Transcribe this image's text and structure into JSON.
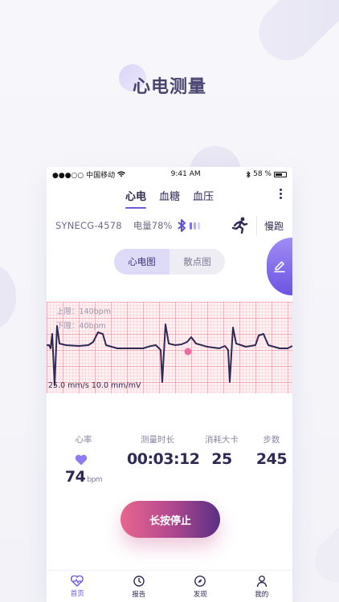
{
  "hero": {
    "title": "心电测量"
  },
  "status_bar": {
    "carrier": "●●●○○ 中国移动",
    "time": "9:41 AM",
    "battery": "58 %"
  },
  "tabs": [
    {
      "label": "心电",
      "active": true
    },
    {
      "label": "血糖",
      "active": false
    },
    {
      "label": "血压",
      "active": false
    }
  ],
  "device": {
    "name": "SYNECG-4578",
    "battery_text": "电量78%",
    "bluetooth": "✱",
    "activity_label": "慢跑"
  },
  "segment": {
    "options": [
      "心电图",
      "散点图"
    ],
    "selected": "心电图"
  },
  "ecg": {
    "upper_limit": "上限：140bpm",
    "lower_limit": "下限：40bpm",
    "speed": "25.0 mm/s 10.0 mm/mV"
  },
  "stats": [
    {
      "label": "心率",
      "value": "74",
      "unit": "bpm"
    },
    {
      "label": "测量时长",
      "value": "00:03:12"
    },
    {
      "label": "消耗大卡",
      "value": "25"
    },
    {
      "label": "步数",
      "value": "245"
    }
  ],
  "stop_button": {
    "label": "长按停止"
  },
  "bottom_nav": [
    {
      "label": "首页",
      "icon": "heart-pulse-icon",
      "active": true
    },
    {
      "label": "报告",
      "icon": "report-icon",
      "active": false
    },
    {
      "label": "发现",
      "icon": "compass-icon",
      "active": false
    },
    {
      "label": "我的",
      "icon": "profile-icon",
      "active": false
    }
  ],
  "colors": {
    "accent": "#6d54e3",
    "stop_gradient_start": "#e8668f",
    "stop_gradient_end": "#5a2e83",
    "ecg_grid": "#f0aab4"
  }
}
